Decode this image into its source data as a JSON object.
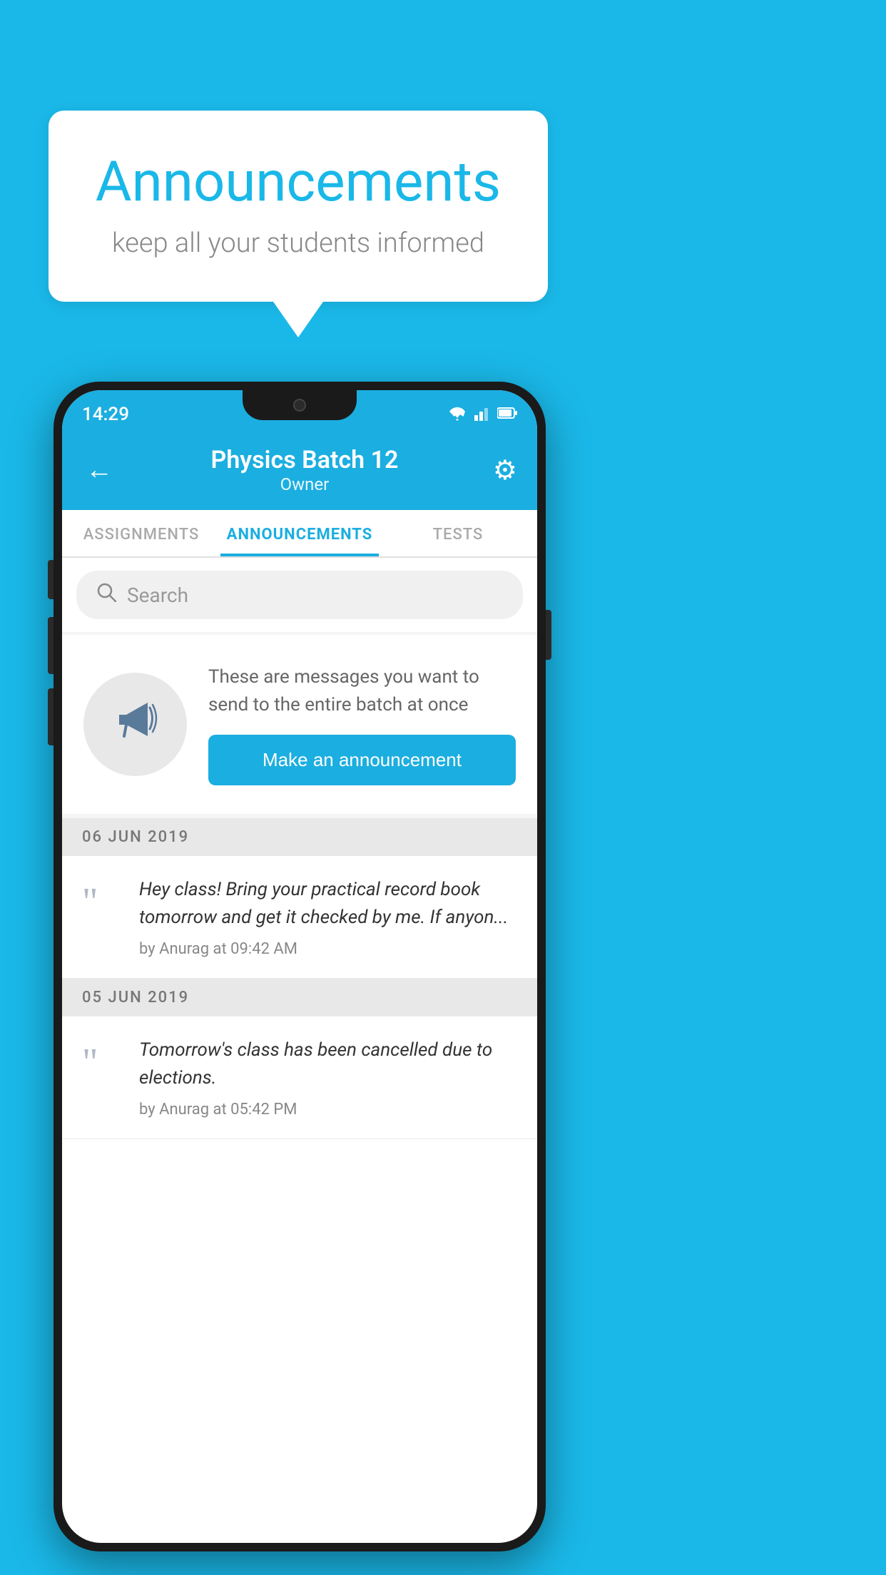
{
  "background_color": "#1ab8e8",
  "speech_bubble": {
    "title": "Announcements",
    "subtitle": "keep all your students informed"
  },
  "phone": {
    "status_bar": {
      "time": "14:29",
      "wifi": "▼",
      "signal": "▲",
      "battery": "▮"
    },
    "app_bar": {
      "title": "Physics Batch 12",
      "subtitle": "Owner",
      "back_label": "←",
      "gear_label": "⚙"
    },
    "tabs": [
      {
        "label": "ASSIGNMENTS",
        "active": false
      },
      {
        "label": "ANNOUNCEMENTS",
        "active": true
      },
      {
        "label": "TESTS",
        "active": false
      }
    ],
    "search": {
      "placeholder": "Search"
    },
    "announcement_prompt": {
      "description": "These are messages you want to send to the entire batch at once",
      "button_label": "Make an announcement"
    },
    "announcements": [
      {
        "date": "06  JUN  2019",
        "items": [
          {
            "text": "Hey class! Bring your practical record book tomorrow and get it checked by me. If anyon...",
            "meta": "by Anurag at 09:42 AM"
          }
        ]
      },
      {
        "date": "05  JUN  2019",
        "items": [
          {
            "text": "Tomorrow's class has been cancelled due to elections.",
            "meta": "by Anurag at 05:42 PM"
          }
        ]
      }
    ]
  }
}
